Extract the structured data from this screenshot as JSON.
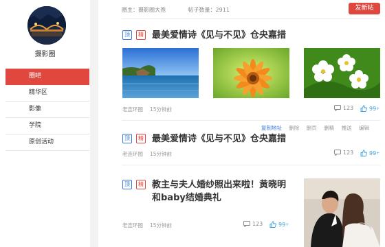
{
  "sidebar": {
    "forum_name": "摄影圈",
    "items": [
      {
        "label": "圈吧",
        "active": true
      },
      {
        "label": "精华区",
        "active": false
      },
      {
        "label": " 影像",
        "active": false
      },
      {
        "label": "学院",
        "active": false
      },
      {
        "label": "原创活动",
        "active": false
      }
    ]
  },
  "header": {
    "owner": "圈主：摄影圈大孢",
    "post_count": "帖子数量：2911",
    "publish_label": "发新帖"
  },
  "badges": {
    "top": "顶",
    "essence": "精"
  },
  "posts": [
    {
      "title": "最美爱情诗《见与不见》仓央嘉措",
      "author": "老连环图",
      "time": "15分钟前",
      "comments": "123",
      "likes": "99",
      "plus": "+"
    },
    {
      "title": "最美爱情诗《见与不见》仓央嘉措",
      "author": "老连环图",
      "time": "15分钟前",
      "comments": "123",
      "likes": "99",
      "plus": "+"
    },
    {
      "title_line1": "教主与夫人婚纱照出来啦！黄晓明",
      "title_line2": "和baby结婚典礼",
      "author": "老连环图",
      "time": "15分钟前",
      "comments": "123",
      "likes": "99",
      "plus": "+"
    }
  ],
  "admin_actions": [
    "复制地址",
    "删除",
    "删页",
    "删精",
    "推送",
    "编辑"
  ],
  "icons": {
    "comment": "comment-icon",
    "like": "thumb-up-icon"
  },
  "colors": {
    "accent": "#e0473f",
    "blue": "#3a7bd5"
  }
}
